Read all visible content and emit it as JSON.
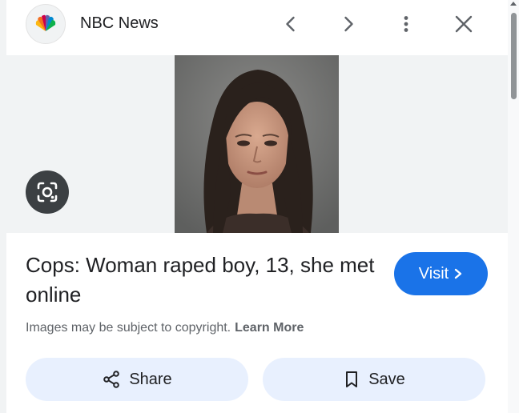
{
  "header": {
    "source_name": "NBC News",
    "favicon_icon": "nbc-peacock-icon",
    "prev_icon": "chevron-left-icon",
    "next_icon": "chevron-right-icon",
    "more_icon": "more-vert-icon",
    "close_icon": "close-icon"
  },
  "image": {
    "lens_icon": "lens-search-icon"
  },
  "result": {
    "title": "Cops: Woman raped boy, 13, she met online",
    "visit_label": "Visit",
    "copyright_text": "Images may be subject to copyright.",
    "learn_more_label": "Learn More"
  },
  "actions": {
    "share_label": "Share",
    "save_label": "Save"
  },
  "colors": {
    "accent": "#1a73e8",
    "action_bg": "#e8f0fe",
    "image_bg": "#f1f3f4"
  }
}
